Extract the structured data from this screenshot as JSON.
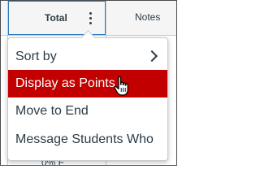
{
  "header": {
    "total_label": "Total",
    "notes_label": "Notes"
  },
  "background": {
    "peek_text": "0% F"
  },
  "menu": {
    "items": [
      {
        "label": "Sort by",
        "has_submenu": true
      },
      {
        "label": "Display as Points",
        "highlighted": true
      },
      {
        "label": "Move to End"
      },
      {
        "label": "Message Students Who"
      }
    ],
    "highlight_color": "#c20000"
  },
  "icons": {
    "kebab": "more-vertical-icon",
    "submenu": "chevron-right-icon",
    "cursor": "hand-pointer-icon"
  }
}
